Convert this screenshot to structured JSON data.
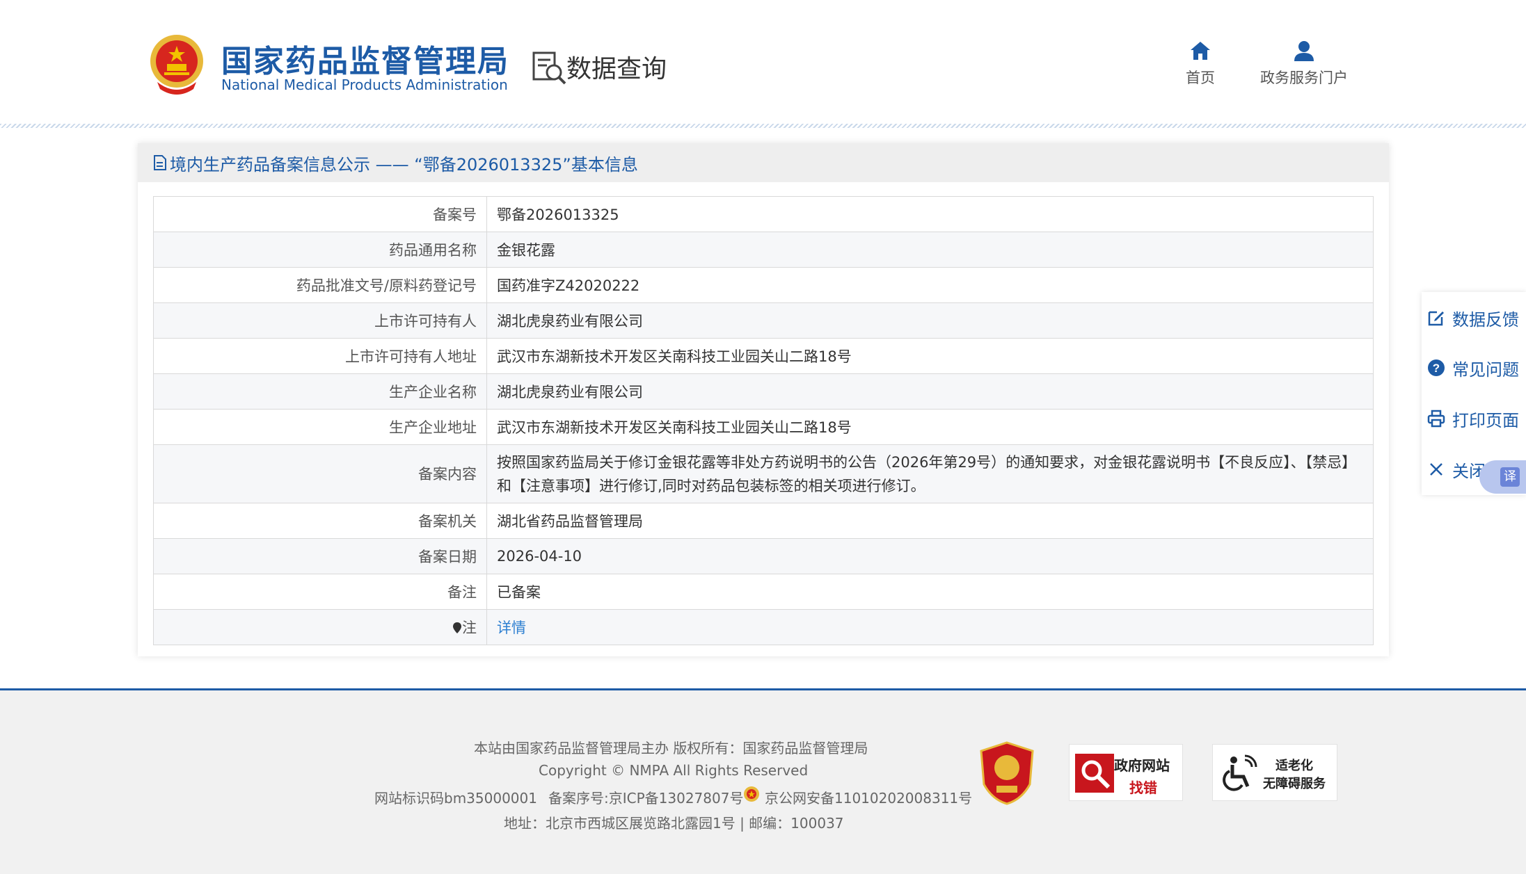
{
  "header": {
    "org_cn": "国家药品监督管理局",
    "org_en": "National Medical Products Administration",
    "section_title": "数据查询",
    "nav": [
      {
        "label": "首页",
        "icon": "home-icon"
      },
      {
        "label": "政务服务门户",
        "icon": "user-icon"
      }
    ]
  },
  "panel": {
    "title": "境内生产药品备案信息公示 —— “鄂备2026013325”基本信息",
    "rows": [
      {
        "key": "备案号",
        "value": "鄂备2026013325"
      },
      {
        "key": "药品通用名称",
        "value": "金银花露"
      },
      {
        "key": "药品批准文号/原料药登记号",
        "value": "国药准字Z42020222"
      },
      {
        "key": "上市许可持有人",
        "value": "湖北虎泉药业有限公司"
      },
      {
        "key": "上市许可持有人地址",
        "value": "武汉市东湖新技术开发区关南科技工业园关山二路18号"
      },
      {
        "key": "生产企业名称",
        "value": "湖北虎泉药业有限公司"
      },
      {
        "key": "生产企业地址",
        "value": "武汉市东湖新技术开发区关南科技工业园关山二路18号"
      },
      {
        "key": "备案内容",
        "value": "按照国家药监局关于修订金银花露等非处方药说明书的公告（2026年第29号）的通知要求，对金银花露说明书【不良反应】、【禁忌】和【注意事项】进行修订,同时对药品包装标签的相关项进行修订。"
      },
      {
        "key": "备案机关",
        "value": "湖北省药品监督管理局"
      },
      {
        "key": "备案日期",
        "value": "2026-04-10"
      },
      {
        "key": "备注",
        "value": "已备案"
      }
    ],
    "note_key": "注",
    "note_link": "详情"
  },
  "side_tools": [
    {
      "label": "数据反馈",
      "icon": "edit-icon"
    },
    {
      "label": "常见问题",
      "icon": "help-icon"
    },
    {
      "label": "打印页面",
      "icon": "print-icon"
    },
    {
      "label": "关闭页面",
      "icon": "close-icon"
    }
  ],
  "translate_label": "译",
  "footer": {
    "line1": "本站由国家药品监督管理局主办 版权所有：国家药品监督管理局",
    "line2": "Copyright © NMPA All Rights Reserved",
    "site_id": "网站标识码bm35000001",
    "icp": "备案序号:京ICP备13027807号",
    "police": "京公网安备11010202008311号",
    "address": "地址：北京市西城区展览路北露园1号 | 邮编：100037",
    "badge_gov_line1": "政府网站",
    "badge_gov_line2": "找错",
    "badge_access_line1": "适老化",
    "badge_access_line2": "无障碍服务"
  },
  "colors": {
    "brand": "#1d5ba6",
    "link": "#2f80d1",
    "emblem_red": "#d7261e",
    "gold": "#f2c200"
  }
}
